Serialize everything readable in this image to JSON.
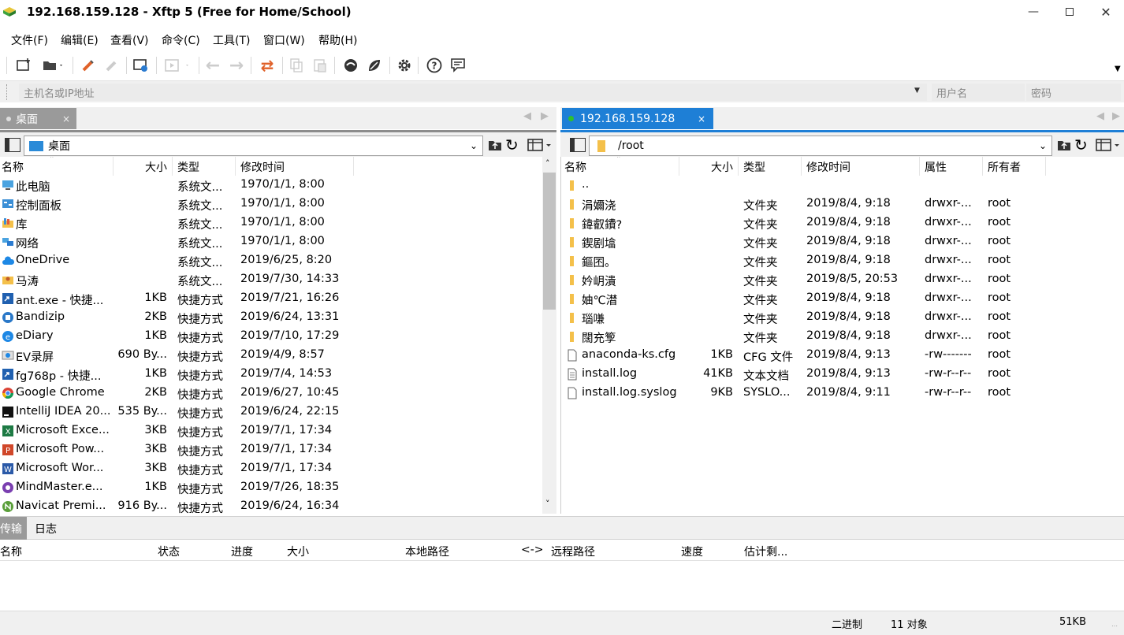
{
  "window": {
    "title": "192.168.159.128   - Xftp 5 (Free for Home/School)"
  },
  "menu": [
    "文件(F)",
    "编辑(E)",
    "查看(V)",
    "命令(C)",
    "工具(T)",
    "窗口(W)",
    "帮助(H)"
  ],
  "address": {
    "host_placeholder": "主机名或IP地址",
    "user_placeholder": "用户名",
    "password_placeholder": "密码"
  },
  "left": {
    "tab": "桌面",
    "path": "桌面",
    "headers": [
      "名称",
      "大小",
      "类型",
      "修改时间"
    ],
    "rows": [
      {
        "name": "此电脑",
        "size": "",
        "type": "系统文...",
        "mtime": "1970/1/1, 8:00",
        "icon": "computer-icon"
      },
      {
        "name": "控制面板",
        "size": "",
        "type": "系统文...",
        "mtime": "1970/1/1, 8:00",
        "icon": "control-panel-icon"
      },
      {
        "name": "库",
        "size": "",
        "type": "系统文...",
        "mtime": "1970/1/1, 8:00",
        "icon": "library-icon"
      },
      {
        "name": "网络",
        "size": "",
        "type": "系统文...",
        "mtime": "1970/1/1, 8:00",
        "icon": "network-icon"
      },
      {
        "name": "OneDrive",
        "size": "",
        "type": "系统文...",
        "mtime": "2019/6/25, 8:20",
        "icon": "cloud-icon"
      },
      {
        "name": "马涛",
        "size": "",
        "type": "系统文...",
        "mtime": "2019/7/30, 14:33",
        "icon": "user-folder-icon"
      },
      {
        "name": "ant.exe - 快捷...",
        "size": "1KB",
        "type": "快捷方式",
        "mtime": "2019/7/21, 16:26",
        "icon": "shortcut-icon"
      },
      {
        "name": "Bandizip",
        "size": "2KB",
        "type": "快捷方式",
        "mtime": "2019/6/24, 13:31",
        "icon": "bandizip-icon"
      },
      {
        "name": "eDiary",
        "size": "1KB",
        "type": "快捷方式",
        "mtime": "2019/7/10, 17:29",
        "icon": "ediary-icon"
      },
      {
        "name": "EV录屏",
        "size": "690 By...",
        "type": "快捷方式",
        "mtime": "2019/4/9, 8:57",
        "icon": "recorder-icon"
      },
      {
        "name": "fg768p - 快捷...",
        "size": "1KB",
        "type": "快捷方式",
        "mtime": "2019/7/4, 14:53",
        "icon": "shortcut-icon"
      },
      {
        "name": "Google Chrome",
        "size": "2KB",
        "type": "快捷方式",
        "mtime": "2019/6/27, 10:45",
        "icon": "chrome-icon"
      },
      {
        "name": "IntelliJ IDEA 20...",
        "size": "535 By...",
        "type": "快捷方式",
        "mtime": "2019/6/24, 22:15",
        "icon": "intellij-icon"
      },
      {
        "name": "Microsoft Exce...",
        "size": "3KB",
        "type": "快捷方式",
        "mtime": "2019/7/1, 17:34",
        "icon": "excel-icon"
      },
      {
        "name": "Microsoft Pow...",
        "size": "3KB",
        "type": "快捷方式",
        "mtime": "2019/7/1, 17:34",
        "icon": "powerpoint-icon"
      },
      {
        "name": "Microsoft Wor...",
        "size": "3KB",
        "type": "快捷方式",
        "mtime": "2019/7/1, 17:34",
        "icon": "word-icon"
      },
      {
        "name": "MindMaster.e...",
        "size": "1KB",
        "type": "快捷方式",
        "mtime": "2019/7/26, 18:35",
        "icon": "mindmaster-icon"
      },
      {
        "name": "Navicat Premi...",
        "size": "916 By...",
        "type": "快捷方式",
        "mtime": "2019/6/24, 16:34",
        "icon": "navicat-icon"
      }
    ]
  },
  "right": {
    "tab": "192.168.159.128",
    "path": "/root",
    "headers": [
      "名称",
      "大小",
      "类型",
      "修改时间",
      "属性",
      "所有者"
    ],
    "rows": [
      {
        "name": "..",
        "size": "",
        "type": "",
        "mtime": "",
        "perm": "",
        "owner": "",
        "icon": "folder-icon"
      },
      {
        "name": "涓嬭浇",
        "size": "",
        "type": "文件夹",
        "mtime": "2019/8/4, 9:18",
        "perm": "drwxr-...",
        "owner": "root",
        "icon": "folder-icon"
      },
      {
        "name": "鍏叡鐨?",
        "size": "",
        "type": "文件夹",
        "mtime": "2019/8/4, 9:18",
        "perm": "drwxr-...",
        "owner": "root",
        "icon": "folder-icon"
      },
      {
        "name": "鍥剧墖",
        "size": "",
        "type": "文件夹",
        "mtime": "2019/8/4, 9:18",
        "perm": "drwxr-...",
        "owner": "root",
        "icon": "folder-icon"
      },
      {
        "name": "鏂囨。",
        "size": "",
        "type": "文件夹",
        "mtime": "2019/8/4, 9:18",
        "perm": "drwxr-...",
        "owner": "root",
        "icon": "folder-icon"
      },
      {
        "name": "妗岄潰",
        "size": "",
        "type": "文件夹",
        "mtime": "2019/8/5, 20:53",
        "perm": "drwxr-...",
        "owner": "root",
        "icon": "folder-icon"
      },
      {
        "name": "妯℃澘",
        "size": "",
        "type": "文件夹",
        "mtime": "2019/8/4, 9:18",
        "perm": "drwxr-...",
        "owner": "root",
        "icon": "folder-icon"
      },
      {
        "name": "瑙嗛",
        "size": "",
        "type": "文件夹",
        "mtime": "2019/8/4, 9:18",
        "perm": "drwxr-...",
        "owner": "root",
        "icon": "folder-icon"
      },
      {
        "name": "闊充箰",
        "size": "",
        "type": "文件夹",
        "mtime": "2019/8/4, 9:18",
        "perm": "drwxr-...",
        "owner": "root",
        "icon": "folder-icon"
      },
      {
        "name": "anaconda-ks.cfg",
        "size": "1KB",
        "type": "CFG 文件",
        "mtime": "2019/8/4, 9:13",
        "perm": "-rw-------",
        "owner": "root",
        "icon": "file-icon"
      },
      {
        "name": "install.log",
        "size": "41KB",
        "type": "文本文档",
        "mtime": "2019/8/4, 9:13",
        "perm": "-rw-r--r--",
        "owner": "root",
        "icon": "text-file-icon"
      },
      {
        "name": "install.log.syslog",
        "size": "9KB",
        "type": "SYSLO...",
        "mtime": "2019/8/4, 9:11",
        "perm": "-rw-r--r--",
        "owner": "root",
        "icon": "file-icon"
      }
    ]
  },
  "transfer": {
    "tabs": [
      "传输",
      "日志"
    ],
    "headers": [
      "名称",
      "状态",
      "进度",
      "大小",
      "本地路径",
      "<->",
      "远程路径",
      "速度",
      "估计剩..."
    ]
  },
  "status": {
    "mode": "二进制",
    "count": "11 对象",
    "size": "51KB"
  },
  "colors": {
    "accent": "#1e7fd6",
    "folder": "#f4c04a",
    "connected": "#2ec02e"
  }
}
